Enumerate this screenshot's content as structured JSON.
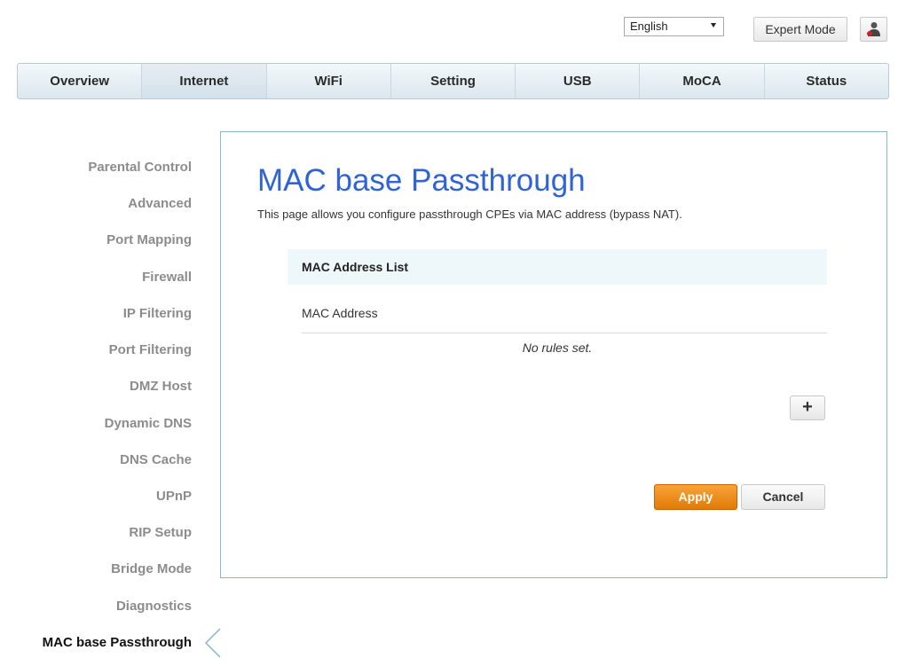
{
  "header": {
    "language": "English",
    "expert_mode_label": "Expert Mode",
    "user_icon": "user-icon"
  },
  "nav": {
    "tabs": [
      "Overview",
      "Internet",
      "WiFi",
      "Setting",
      "USB",
      "MoCA",
      "Status"
    ],
    "active": "Internet"
  },
  "sidebar": {
    "items": [
      "Parental Control",
      "Advanced",
      "Port Mapping",
      "Firewall",
      "IP Filtering",
      "Port Filtering",
      "DMZ Host",
      "Dynamic DNS",
      "DNS Cache",
      "UPnP",
      "RIP Setup",
      "Bridge Mode",
      "Diagnostics",
      "MAC base Passthrough"
    ],
    "active": "MAC base Passthrough"
  },
  "main": {
    "title": "MAC base Passthrough",
    "description": "This page allows you configure passthrough CPEs via MAC address (bypass NAT).",
    "list_title": "MAC Address List",
    "column_header": "MAC Address",
    "empty_text": "No rules set.",
    "add_label": "+",
    "apply_label": "Apply",
    "cancel_label": "Cancel"
  },
  "colors": {
    "title_blue": "#2f63d6",
    "apply_orange": "#e27b05",
    "panel_border": "#88b6cf"
  }
}
